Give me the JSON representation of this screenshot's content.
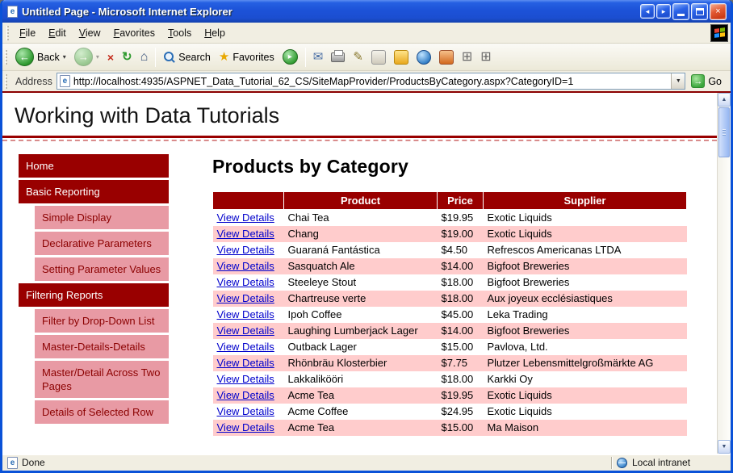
{
  "window": {
    "title": "Untitled Page - Microsoft Internet Explorer"
  },
  "menu": {
    "items": [
      "File",
      "Edit",
      "View",
      "Favorites",
      "Tools",
      "Help"
    ]
  },
  "toolbar": {
    "back": "Back",
    "search": "Search",
    "favorites": "Favorites"
  },
  "address": {
    "label": "Address",
    "url": "http://localhost:4935/ASPNET_Data_Tutorial_62_CS/SiteMapProvider/ProductsByCategory.aspx?CategoryID=1",
    "go": "Go"
  },
  "status": {
    "left": "Done",
    "zone": "Local intranet"
  },
  "icons": {
    "back": "←",
    "forward": "→",
    "stop": "×",
    "refresh": "↻",
    "home": "⌂",
    "star": "★",
    "media": "▸",
    "mail": "✉",
    "edit": "✎",
    "chevron": "▾",
    "go": "→",
    "scroll_up": "▲",
    "scroll_down": "▼",
    "close": "×",
    "e_logo": "e",
    "prev": "◂",
    "next": "▸",
    "grid": "⊞",
    "drop": "▼"
  },
  "page": {
    "header_title": "Working with Data Tutorials",
    "content_title": "Products by Category",
    "sidebar": [
      {
        "label": "Home"
      },
      {
        "label": "Basic Reporting"
      },
      {
        "label": "Simple Display"
      },
      {
        "label": "Declarative Parameters"
      },
      {
        "label": "Setting Parameter Values"
      },
      {
        "label": "Filtering Reports"
      },
      {
        "label": "Filter by Drop-Down List"
      },
      {
        "label": "Master-Details-Details"
      },
      {
        "label": "Master/Detail Across Two Pages"
      },
      {
        "label": "Details of Selected Row"
      }
    ],
    "table": {
      "headers": [
        "",
        "Product",
        "Price",
        "Supplier"
      ],
      "link_label": "View Details",
      "rows": [
        {
          "product": "Chai Tea",
          "price": "$19.95",
          "supplier": "Exotic Liquids"
        },
        {
          "product": "Chang",
          "price": "$19.00",
          "supplier": "Exotic Liquids"
        },
        {
          "product": "Guaraná Fantástica",
          "price": "$4.50",
          "supplier": "Refrescos Americanas LTDA"
        },
        {
          "product": "Sasquatch Ale",
          "price": "$14.00",
          "supplier": "Bigfoot Breweries"
        },
        {
          "product": "Steeleye Stout",
          "price": "$18.00",
          "supplier": "Bigfoot Breweries"
        },
        {
          "product": "Chartreuse verte",
          "price": "$18.00",
          "supplier": "Aux joyeux ecclésiastiques"
        },
        {
          "product": "Ipoh Coffee",
          "price": "$45.00",
          "supplier": "Leka Trading"
        },
        {
          "product": "Laughing Lumberjack Lager",
          "price": "$14.00",
          "supplier": "Bigfoot Breweries"
        },
        {
          "product": "Outback Lager",
          "price": "$15.00",
          "supplier": "Pavlova, Ltd."
        },
        {
          "product": "Rhönbräu Klosterbier",
          "price": "$7.75",
          "supplier": "Plutzer Lebensmittelgroßmärkte AG"
        },
        {
          "product": "Lakkalikööri",
          "price": "$18.00",
          "supplier": "Karkki Oy"
        },
        {
          "product": "Acme Tea",
          "price": "$19.95",
          "supplier": "Exotic Liquids"
        },
        {
          "product": "Acme Coffee",
          "price": "$24.95",
          "supplier": "Exotic Liquids"
        },
        {
          "product": "Acme Tea",
          "price": "$15.00",
          "supplier": "Ma Maison"
        }
      ]
    }
  },
  "colors": {
    "theme_maroon": "#990000",
    "sidebar_pink": "#E89AA4",
    "row_alt_pink": "#FFCCCC",
    "link_blue": "#0000CC",
    "titlebar_blue": "#1C52D8",
    "chrome_gray": "#ECE9D8"
  }
}
